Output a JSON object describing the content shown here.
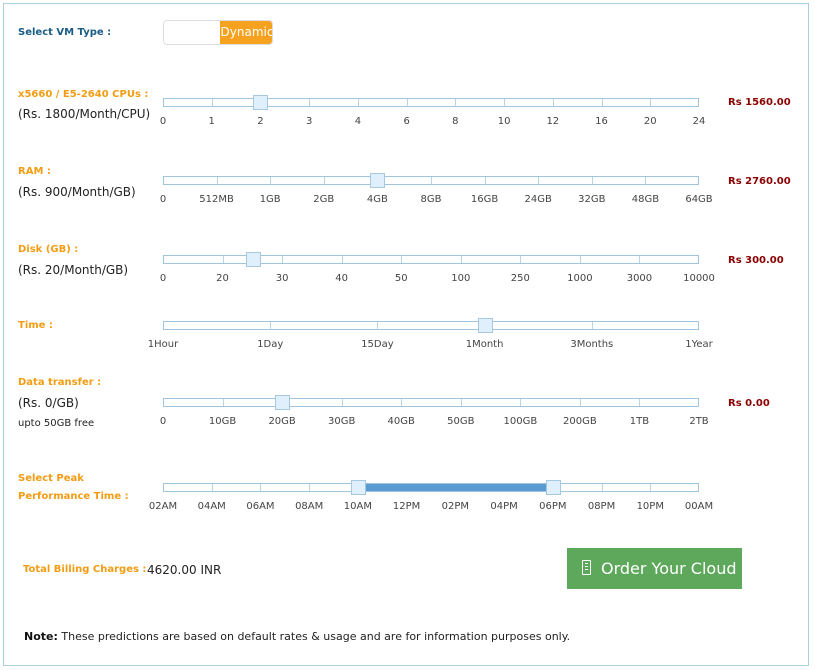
{
  "vm_type": {
    "label": "Select VM Type :",
    "mode_label": "Dynamic"
  },
  "cpu": {
    "label": "x5660 / E5-2640 CPUs :",
    "rate": "(Rs. 1800/Month/CPU)",
    "price": "Rs 1560.00",
    "ticks": [
      "0",
      "1",
      "2",
      "3",
      "4",
      "6",
      "8",
      "10",
      "12",
      "16",
      "20",
      "24"
    ],
    "selected": "2"
  },
  "ram": {
    "label": "RAM :",
    "rate": "(Rs. 900/Month/GB)",
    "price": "Rs 2760.00",
    "ticks": [
      "0",
      "512MB",
      "1GB",
      "2GB",
      "4GB",
      "8GB",
      "16GB",
      "24GB",
      "32GB",
      "48GB",
      "64GB"
    ],
    "selected": "4GB"
  },
  "disk": {
    "label": "Disk (GB) :",
    "rate": "(Rs. 20/Month/GB)",
    "price": "Rs 300.00",
    "ticks": [
      "0",
      "20",
      "30",
      "40",
      "50",
      "100",
      "250",
      "1000",
      "3000",
      "10000"
    ],
    "selected_fraction": 0.167
  },
  "time": {
    "label": "Time :",
    "ticks": [
      "1Hour",
      "1Day",
      "15Day",
      "1Month",
      "3Months",
      "1Year"
    ],
    "selected": "1Month"
  },
  "transfer": {
    "label": "Data transfer :",
    "rate": "(Rs. 0/GB)",
    "note": "upto 50GB free",
    "price": "Rs 0.00",
    "ticks": [
      "0",
      "10GB",
      "20GB",
      "30GB",
      "40GB",
      "50GB",
      "100GB",
      "200GB",
      "1TB",
      "2TB"
    ],
    "selected": "20GB"
  },
  "peak": {
    "label_line1": "Select Peak",
    "label_line2": "Performance Time :",
    "ticks": [
      "02AM",
      "04AM",
      "06AM",
      "08AM",
      "10AM",
      "12PM",
      "02PM",
      "04PM",
      "06PM",
      "08PM",
      "10PM",
      "00AM"
    ],
    "range_start": "10AM",
    "range_end": "06PM",
    "range_color": "#5b9bd1"
  },
  "total": {
    "label": "Total Billing Charges :",
    "value": "4620.00 INR"
  },
  "order": {
    "label": "Order Your Cloud",
    "icon": "calculator-icon",
    "color": "#5da85b"
  },
  "note": {
    "bold": "Note:",
    "text": " These predictions are based on default rates & usage and are for information purposes only."
  },
  "colors": {
    "label_orange": "#f39c12",
    "price_red": "#8b0000",
    "label_blue": "#1b5c85",
    "handle": "#dfeffc"
  }
}
